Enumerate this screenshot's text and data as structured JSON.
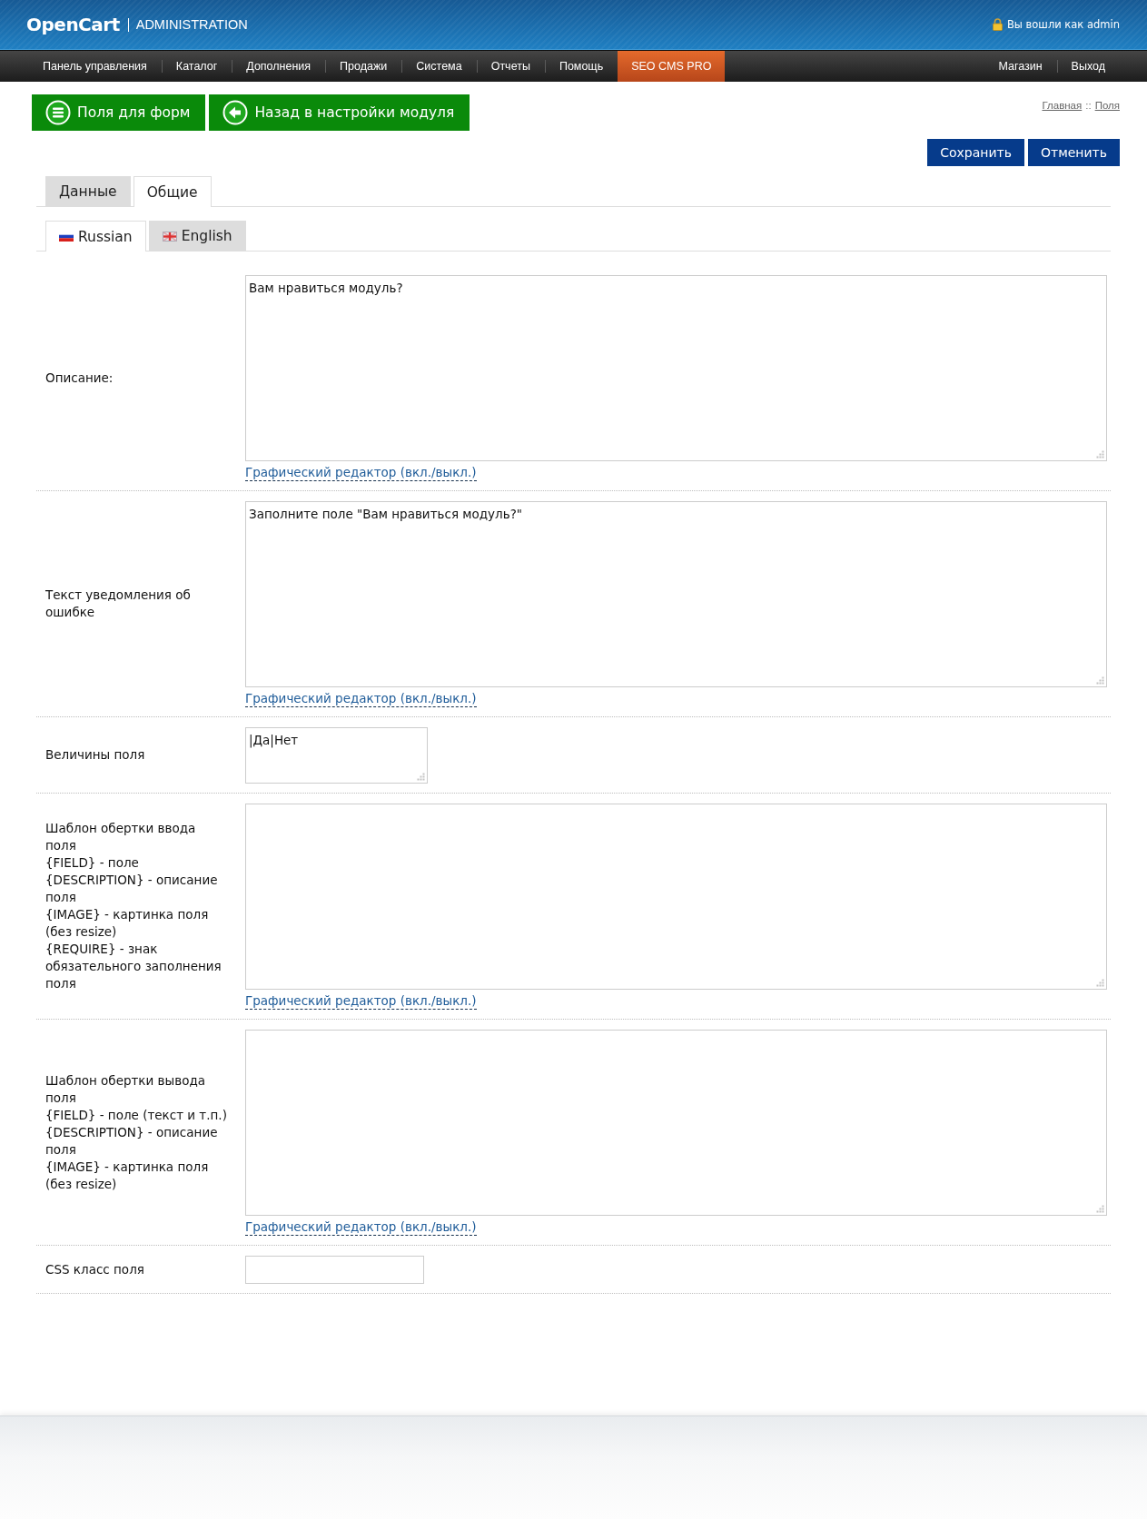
{
  "header": {
    "logo": "OpenCart",
    "subtitle": "ADMINISTRATION",
    "user_text": "Вы вошли как admin"
  },
  "nav": {
    "items": [
      {
        "label": "Панель управления",
        "selected": false
      },
      {
        "label": "Каталог",
        "selected": false
      },
      {
        "label": "Дополнения",
        "selected": false
      },
      {
        "label": "Продажи",
        "selected": false
      },
      {
        "label": "Система",
        "selected": false
      },
      {
        "label": "Отчеты",
        "selected": false
      },
      {
        "label": "Помощь",
        "selected": false
      },
      {
        "label": "SEO CMS PRO",
        "selected": true
      }
    ],
    "right_items": [
      "Магазин",
      "Выход"
    ]
  },
  "toolbar": {
    "buttons": [
      {
        "label": "Поля для форм",
        "kind": "list"
      },
      {
        "label": "Назад в настройки модуля",
        "kind": "back"
      }
    ]
  },
  "breadcrumbs": {
    "items": [
      "Главная",
      "Поля"
    ],
    "separator": "::"
  },
  "actions": [
    "Сохранить",
    "Отменить"
  ],
  "tabs": [
    {
      "label": "Данные",
      "selected": false
    },
    {
      "label": "Общие",
      "selected": true
    }
  ],
  "language_tabs": [
    {
      "label": "Russian",
      "kind": "ru",
      "selected": true
    },
    {
      "label": "English",
      "kind": "en",
      "selected": false
    }
  ],
  "form_rows": [
    {
      "kind": "editor",
      "label": "Описание:",
      "value": "Вам нравиться модуль?",
      "editor_link": "Графический редактор (вкл./выкл.)"
    },
    {
      "kind": "editor",
      "label": "Текст уведомления об ошибке",
      "value": "Заполните поле \"Вам нравиться модуль?\"",
      "editor_link": "Графический редактор (вкл./выкл.)"
    },
    {
      "kind": "textarea",
      "label": "Величины поля",
      "value": "|Да|Нет"
    },
    {
      "kind": "editor",
      "label": "Шаблон обертки ввода поля\n{FIELD} - поле\n{DESCRIPTION} - описание поля\n{IMAGE} - картинка поля (без resize)\n{REQUIRE} - знак обязательного заполнения поля",
      "editor_link": "Графический редактор (вкл./выкл.)"
    },
    {
      "kind": "editor",
      "label": "Шаблон обертки вывода поля\n{FIELD} - поле (текст и т.п.)\n{DESCRIPTION} - описание поля\n{IMAGE} - картинка поля (без resize)",
      "editor_link": "Графический редактор (вкл./выкл.)"
    },
    {
      "kind": "text",
      "label": "CSS класс поля"
    }
  ]
}
